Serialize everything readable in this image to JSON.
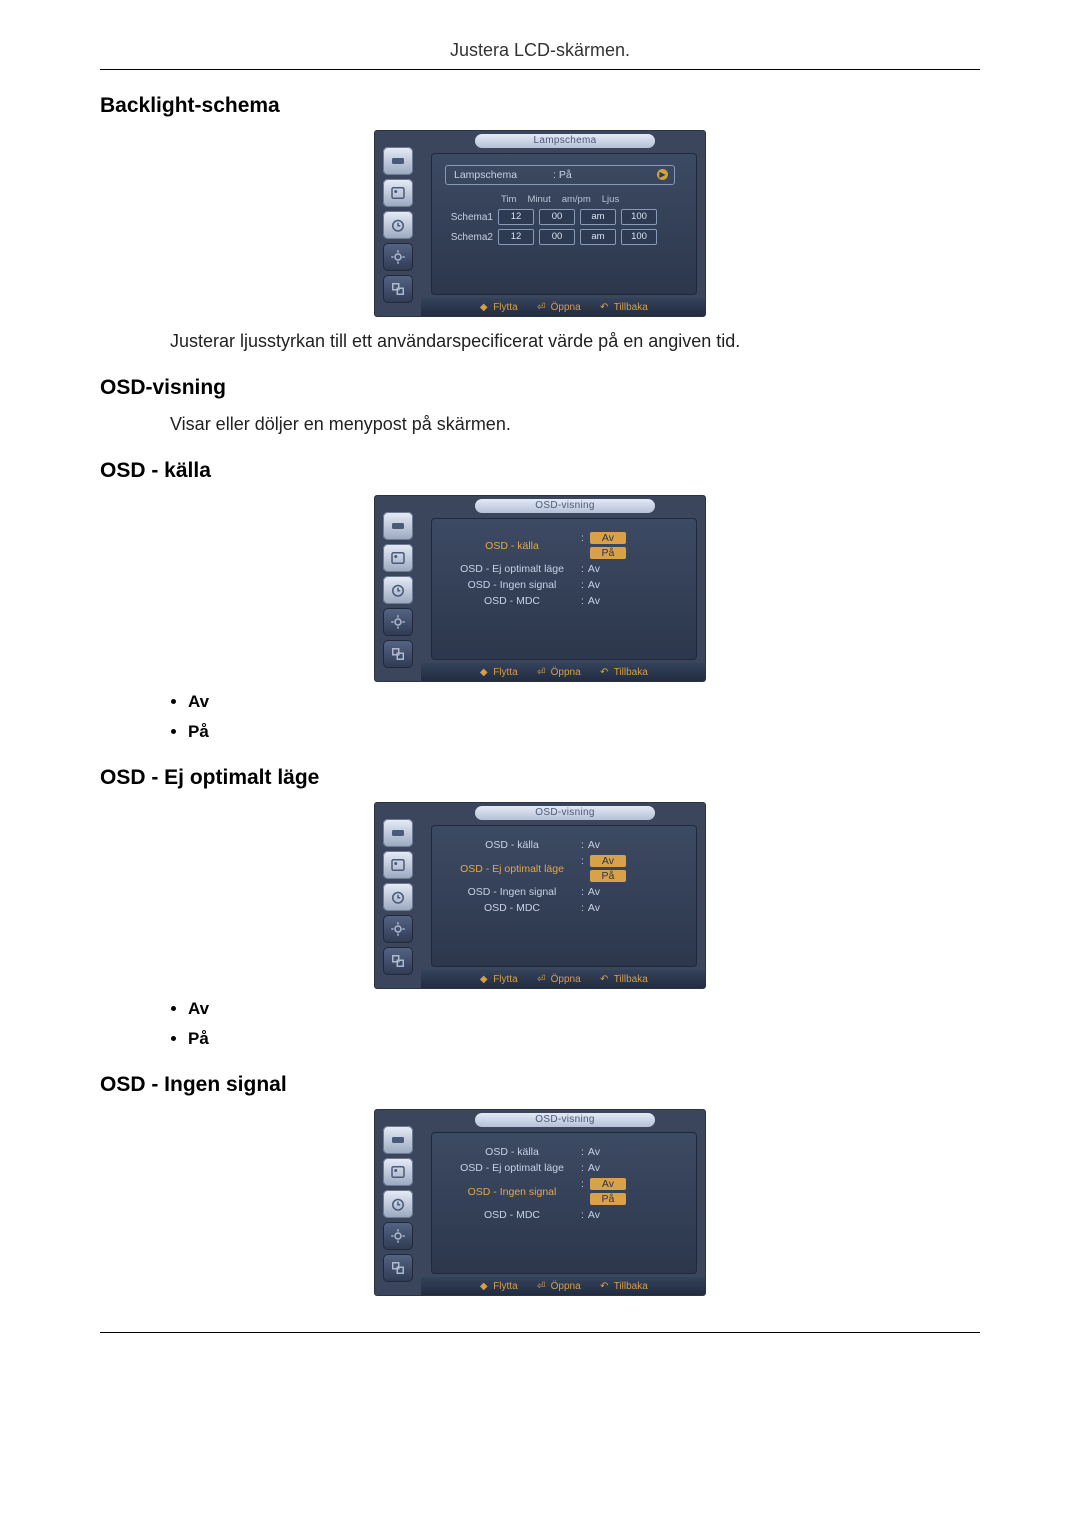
{
  "header": "Justera LCD-skärmen.",
  "sections": {
    "backlight": {
      "title": "Backlight-schema",
      "description": "Justerar ljusstyrkan till ett användarspecificerat värde på en angiven tid."
    },
    "osd_visning": {
      "title": "OSD-visning",
      "description": "Visar eller döljer en menypost på skärmen."
    },
    "osd_kalla": {
      "title": "OSD - källa"
    },
    "osd_ej_opt": {
      "title": "OSD - Ej optimalt läge"
    },
    "osd_ingen": {
      "title": "OSD - Ingen signal"
    }
  },
  "options": {
    "av": "Av",
    "pa": "På"
  },
  "osd_common": {
    "footer": {
      "flytta": "Flytta",
      "oppna": "Öppna",
      "tillbaka": "Tillbaka"
    },
    "title_lampschema": "Lampschema",
    "title_osdvisning": "OSD-visning"
  },
  "lamp_screen": {
    "top_label": "Lampschema",
    "top_value": "På",
    "headers": {
      "tim": "Tim",
      "minut": "Minut",
      "ampm": "am/pm",
      "ljus": "Ljus"
    },
    "rows": [
      {
        "label": "Schema1",
        "tim": "12",
        "minut": "00",
        "ampm": "am",
        "ljus": "100"
      },
      {
        "label": "Schema2",
        "tim": "12",
        "minut": "00",
        "ampm": "am",
        "ljus": "100"
      }
    ]
  },
  "osd_kalla_screen": {
    "rows": [
      {
        "label": "OSD - källa",
        "highlight": true,
        "values": [
          {
            "text": "Av",
            "hi": true
          },
          {
            "text": "På",
            "hi": true
          }
        ]
      },
      {
        "label": "OSD - Ej optimalt läge",
        "highlight": false,
        "values": [
          {
            "text": "Av",
            "hi": false
          }
        ]
      },
      {
        "label": "OSD - Ingen signal",
        "highlight": false,
        "values": [
          {
            "text": "Av",
            "hi": false
          }
        ]
      },
      {
        "label": "OSD - MDC",
        "highlight": false,
        "values": [
          {
            "text": "Av",
            "hi": false
          }
        ]
      }
    ]
  },
  "osd_ejopt_screen": {
    "rows": [
      {
        "label": "OSD - källa",
        "highlight": false,
        "values": [
          {
            "text": "Av",
            "hi": false
          }
        ]
      },
      {
        "label": "OSD - Ej optimalt läge",
        "highlight": true,
        "values": [
          {
            "text": "Av",
            "hi": true
          },
          {
            "text": "På",
            "hi": true
          }
        ]
      },
      {
        "label": "OSD - Ingen signal",
        "highlight": false,
        "values": [
          {
            "text": "Av",
            "hi": false
          }
        ]
      },
      {
        "label": "OSD - MDC",
        "highlight": false,
        "values": [
          {
            "text": "Av",
            "hi": false
          }
        ]
      }
    ]
  },
  "osd_ingen_screen": {
    "rows": [
      {
        "label": "OSD - källa",
        "highlight": false,
        "values": [
          {
            "text": "Av",
            "hi": false
          }
        ]
      },
      {
        "label": "OSD - Ej optimalt läge",
        "highlight": false,
        "values": [
          {
            "text": "Av",
            "hi": false
          }
        ]
      },
      {
        "label": "OSD - Ingen signal",
        "highlight": true,
        "values": [
          {
            "text": "Av",
            "hi": true
          },
          {
            "text": "På",
            "hi": true
          }
        ]
      },
      {
        "label": "OSD - MDC",
        "highlight": false,
        "values": [
          {
            "text": "Av",
            "hi": false
          }
        ]
      }
    ]
  },
  "icons": {
    "sidebar": [
      "input-icon",
      "image-icon",
      "timer-icon",
      "settings-icon",
      "multi-icon"
    ]
  }
}
